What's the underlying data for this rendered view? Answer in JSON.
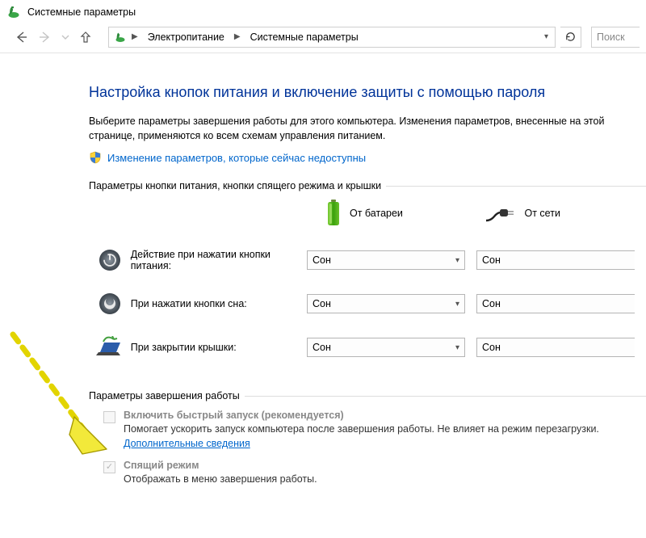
{
  "window": {
    "title": "Системные параметры"
  },
  "nav": {
    "breadcrumb": [
      "Электропитание",
      "Системные параметры"
    ],
    "search_placeholder": "Поиск"
  },
  "page": {
    "heading": "Настройка кнопок питания и включение защиты с помощью пароля",
    "intro": "Выберите параметры завершения работы для этого компьютера. Изменения параметров, внесенные на этой странице, применяются ко всем схемам управления питанием.",
    "unlock_link": "Изменение параметров, которые сейчас недоступны",
    "section1_label": "Параметры кнопки питания, кнопки спящего режима и крышки",
    "columns": {
      "battery": "От батареи",
      "plugged": "От сети"
    },
    "rows": [
      {
        "id": "power-button",
        "label": "Действие при нажатии кнопки питания:",
        "battery": "Сон",
        "plugged": "Сон"
      },
      {
        "id": "sleep-button",
        "label": "При нажатии кнопки сна:",
        "battery": "Сон",
        "plugged": "Сон"
      },
      {
        "id": "lid-close",
        "label": "При закрытии крышки:",
        "battery": "Сон",
        "plugged": "Сон"
      }
    ],
    "section2_label": "Параметры завершения работы",
    "shutdown_options": [
      {
        "id": "fast-startup",
        "title": "Включить быстрый запуск (рекомендуется)",
        "desc_prefix": "Помогает ускорить запуск компьютера после завершения работы. Не влияет на режим перезагрузки. ",
        "more_link": "Дополнительные сведения",
        "checked": false,
        "disabled": true
      },
      {
        "id": "sleep",
        "title": "Спящий режим",
        "desc": "Отображать в меню завершения работы.",
        "checked": true,
        "disabled": true
      }
    ]
  }
}
